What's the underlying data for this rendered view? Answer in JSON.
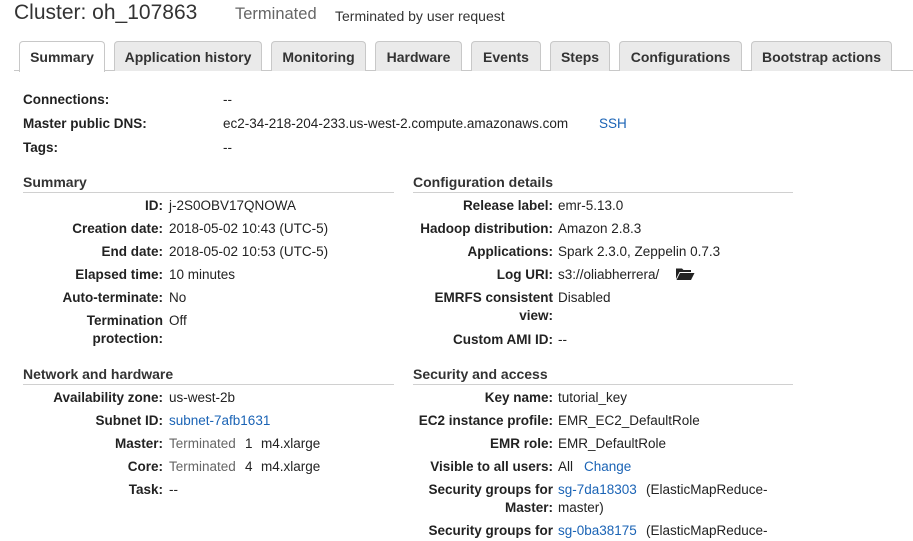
{
  "header": {
    "title": "Cluster: oh_107863",
    "status": "Terminated",
    "status_reason": "Terminated by user request"
  },
  "tabs": [
    {
      "label": "Summary",
      "active": true
    },
    {
      "label": "Application history"
    },
    {
      "label": "Monitoring"
    },
    {
      "label": "Hardware"
    },
    {
      "label": "Events"
    },
    {
      "label": "Steps"
    },
    {
      "label": "Configurations"
    },
    {
      "label": "Bootstrap actions"
    }
  ],
  "top": {
    "connections_label": "Connections:",
    "connections_value": "--",
    "dns_label": "Master public DNS:",
    "dns_value": "ec2-34-218-204-233.us-west-2.compute.amazonaws.com",
    "ssh_link": "SSH",
    "tags_label": "Tags:",
    "tags_value": "--"
  },
  "summary": {
    "heading": "Summary",
    "id_label": "ID:",
    "id_value": "j-2S0OBV17QNOWA",
    "creation_label": "Creation date:",
    "creation_value": "2018-05-02 10:43 (UTC-5)",
    "end_label": "End date:",
    "end_value": "2018-05-02 10:53 (UTC-5)",
    "elapsed_label": "Elapsed time:",
    "elapsed_value": "10 minutes",
    "autoterm_label": "Auto-terminate:",
    "autoterm_value": "No",
    "termprot_label_1": "Termination",
    "termprot_label_2": "protection:",
    "termprot_value": "Off"
  },
  "network": {
    "heading": "Network and hardware",
    "az_label": "Availability zone:",
    "az_value": "us-west-2b",
    "subnet_label": "Subnet ID:",
    "subnet_value": "subnet-7afb1631",
    "master_label": "Master:",
    "master_state": "Terminated",
    "master_count": "1",
    "master_type": "m4.xlarge",
    "core_label": "Core:",
    "core_state": "Terminated",
    "core_count": "4",
    "core_type": "m4.xlarge",
    "task_label": "Task:",
    "task_value": "--"
  },
  "config": {
    "heading": "Configuration details",
    "release_label": "Release label:",
    "release_value": "emr-5.13.0",
    "hadoop_label": "Hadoop distribution:",
    "hadoop_value": "Amazon 2.8.3",
    "apps_label": "Applications:",
    "apps_value": "Spark 2.3.0, Zeppelin 0.7.3",
    "loguri_label": "Log URI:",
    "loguri_value": "s3://oliabherrera/",
    "emrfs_label_1": "EMRFS consistent",
    "emrfs_label_2": "view:",
    "emrfs_value": "Disabled",
    "ami_label": "Custom AMI ID:",
    "ami_value": "--"
  },
  "security": {
    "heading": "Security and access",
    "key_label": "Key name:",
    "key_value": "tutorial_key",
    "profile_label": "EC2 instance profile:",
    "profile_value": "EMR_EC2_DefaultRole",
    "role_label": "EMR role:",
    "role_value": "EMR_DefaultRole",
    "visible_label": "Visible to all users:",
    "visible_value": "All",
    "visible_change": "Change",
    "sg_master_label_1": "Security groups for",
    "sg_master_label_2": "Master:",
    "sg_master_link": "sg-7da18303",
    "sg_master_suffix_1": "(ElasticMapReduce-",
    "sg_master_suffix_2": "master)",
    "sg_core_label_1": "Security groups for",
    "sg_core_link": "sg-0ba38175",
    "sg_core_suffix_1": "(ElasticMapReduce-"
  }
}
